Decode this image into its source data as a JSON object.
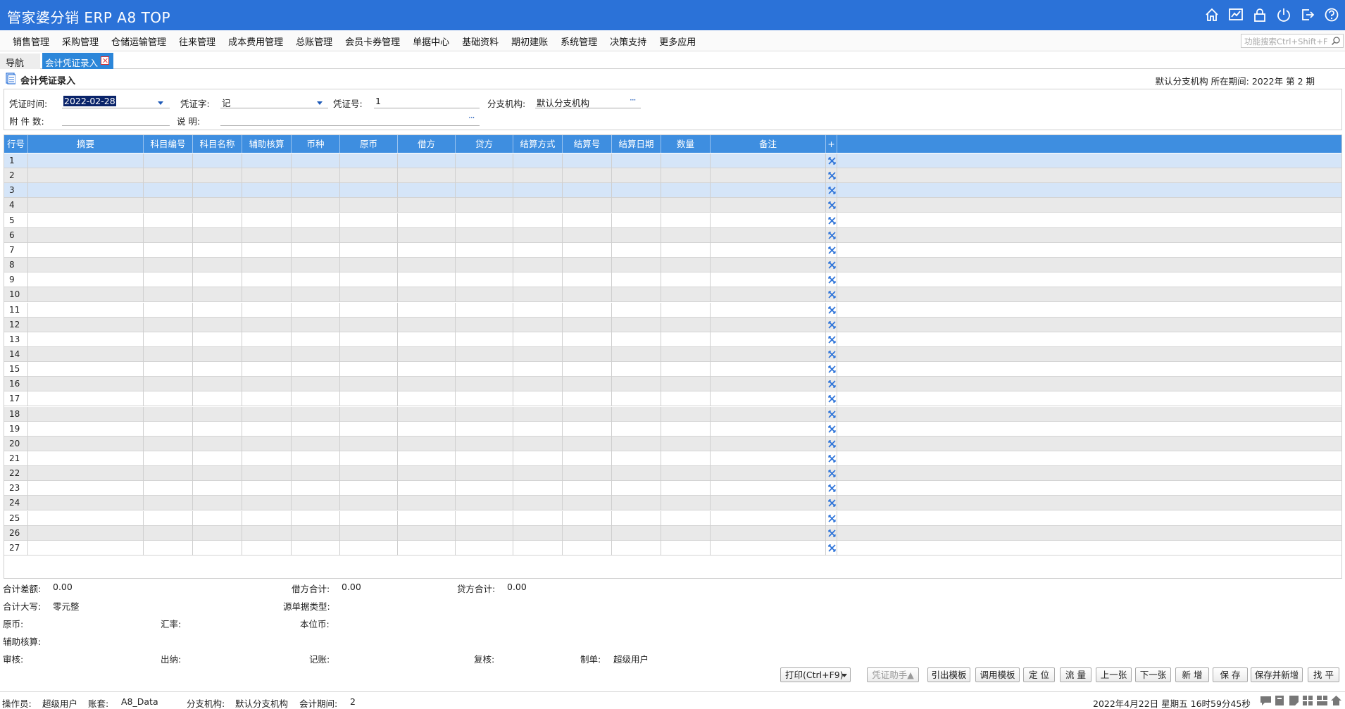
{
  "app": {
    "title": "管家婆分销 ERP A8 TOP"
  },
  "title_icons": [
    "home-icon",
    "chart-icon",
    "lock-icon",
    "power-icon",
    "exit-icon",
    "help-icon"
  ],
  "menu": [
    "销售管理",
    "采购管理",
    "仓储运输管理",
    "往来管理",
    "成本费用管理",
    "总账管理",
    "会员卡券管理",
    "单据中心",
    "基础资料",
    "期初建账",
    "系统管理",
    "决策支持",
    "更多应用"
  ],
  "search": {
    "placeholder": "功能搜索Ctrl+Shift+F"
  },
  "tabs": {
    "nav": "导航",
    "active": "会计凭证录入"
  },
  "section": {
    "title": "会计凭证录入",
    "period": "默认分支机构  所在期间:    2022年  第  2 期"
  },
  "form": {
    "date_label": "凭证时间:",
    "date_value": "2022-02-28",
    "word_label": "凭证字:",
    "word_value": "记",
    "no_label": "凭证号:",
    "no_value": "1",
    "branch_label": "分支机构:",
    "branch_value": "默认分支机构",
    "attach_label": "附 件  数:",
    "attach_value": "",
    "desc_label": "说    明:",
    "desc_value": ""
  },
  "grid": {
    "columns": [
      "行号",
      "摘要",
      "科目编号",
      "科目名称",
      "辅助核算",
      "币种",
      "原币",
      "借方",
      "贷方",
      "结算方式",
      "结算号",
      "结算日期",
      "数量",
      "备注",
      "+"
    ],
    "rows": [
      "1",
      "2",
      "3",
      "4",
      "5",
      "6",
      "7",
      "8",
      "9",
      "10",
      "11",
      "12",
      "13",
      "14",
      "15",
      "16",
      "17",
      "18",
      "19",
      "20",
      "21",
      "22",
      "23",
      "24",
      "25",
      "26",
      "27"
    ],
    "row_icon": "delete-row-icon"
  },
  "summary": {
    "diff_label": "合计差额:",
    "diff_value": "0.00",
    "debit_label": "借方合计:",
    "debit_value": "0.00",
    "credit_label": "贷方合计:",
    "credit_value": "0.00",
    "upper_label": "合计大写:",
    "upper_value": "零元整",
    "source_label": "源单据类型:",
    "orig_label": "原币:",
    "rate_label": "汇率:",
    "local_label": "本位币:",
    "aux_label": "辅助核算:",
    "audit_label": "审核:",
    "cashier_label": "出纳:",
    "post_label": "记账:",
    "review_label": "复核:",
    "maker_label": "制单:",
    "maker_value": "超级用户"
  },
  "buttons": {
    "print": "打印(Ctrl+F9)",
    "assistant": "凭证助手▲",
    "export_tpl": "引出模板",
    "use_tpl": "调用模板",
    "locate": "定 位",
    "flow": "流 量",
    "prev": "上一张",
    "next": "下一张",
    "new": "新 增",
    "save": "保 存",
    "save_new": "保存并新增",
    "balance": "找 平"
  },
  "status": {
    "operator_label": "操作员:",
    "operator_value": "超级用户",
    "account_label": "账套:",
    "account_value": "A8_Data",
    "branch_label": "分支机构:",
    "branch_value": "默认分支机构",
    "period_label": "会计期间:",
    "period_value": "2",
    "datetime": "2022年4月22日  星期五  16时59分45秒"
  },
  "colors": {
    "accent": "#2b72d8",
    "grid_header": "#3e8ee0",
    "selected_row": "#d5e5f8"
  }
}
